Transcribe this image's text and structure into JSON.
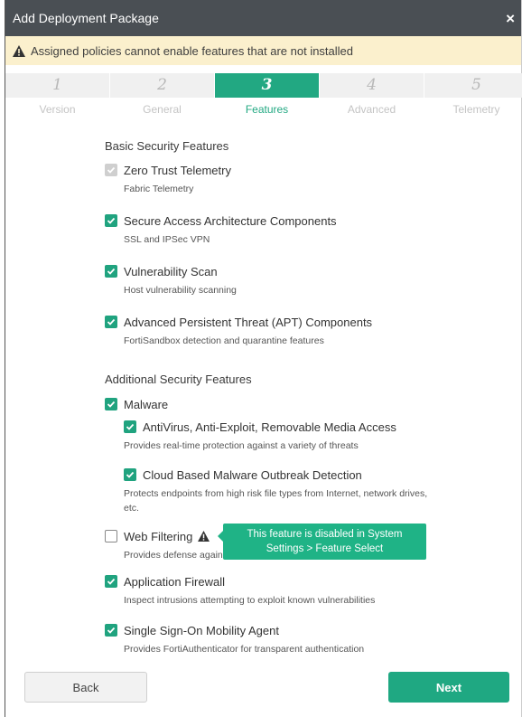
{
  "dialog": {
    "title": "Add Deployment Package",
    "close_label": "×",
    "warning": "Assigned policies cannot enable features that are not installed"
  },
  "steps": [
    {
      "num": "1",
      "label": "Version",
      "active": false
    },
    {
      "num": "2",
      "label": "General",
      "active": false
    },
    {
      "num": "3",
      "label": "Features",
      "active": true
    },
    {
      "num": "4",
      "label": "Advanced",
      "active": false
    },
    {
      "num": "5",
      "label": "Telemetry",
      "active": false
    }
  ],
  "basic": {
    "title": "Basic Security Features",
    "items": [
      {
        "label": "Zero Trust Telemetry",
        "desc": "Fabric Telemetry",
        "state": "disabled-checked"
      },
      {
        "label": "Secure Access Architecture Components",
        "desc": "SSL and IPSec VPN",
        "state": "checked"
      },
      {
        "label": "Vulnerability Scan",
        "desc": "Host vulnerability scanning",
        "state": "checked"
      },
      {
        "label": "Advanced Persistent Threat (APT) Components",
        "desc": "FortiSandbox detection and quarantine features",
        "state": "checked"
      }
    ]
  },
  "additional": {
    "title": "Additional Security Features",
    "malware": {
      "label": "Malware",
      "state": "checked",
      "sub": [
        {
          "label": "AntiVirus, Anti-Exploit, Removable Media Access",
          "desc": "Provides real-time protection against a variety of threats",
          "state": "checked"
        },
        {
          "label": "Cloud Based Malware Outbreak Detection",
          "desc": "Protects endpoints from high risk file types from Internet, network drives, etc.",
          "state": "checked"
        }
      ]
    },
    "web_filtering": {
      "label": "Web Filtering",
      "desc": "Provides defense against web",
      "state": "unchecked",
      "tooltip_line1": "This feature is disabled in System",
      "tooltip_line2": "Settings > Feature Select"
    },
    "app_firewall": {
      "label": "Application Firewall",
      "desc": "Inspect intrusions attempting to exploit known vulnerabilities",
      "state": "checked"
    },
    "sso": {
      "label": "Single Sign-On Mobility Agent",
      "desc": "Provides FortiAuthenticator for transparent authentication",
      "state": "checked"
    }
  },
  "buttons": {
    "back": "Back",
    "next": "Next"
  },
  "colors": {
    "accent": "#1fa882",
    "titlebar": "#4a4f54",
    "warning_bg": "#fbf0cd",
    "tooltip": "#1fb386"
  }
}
